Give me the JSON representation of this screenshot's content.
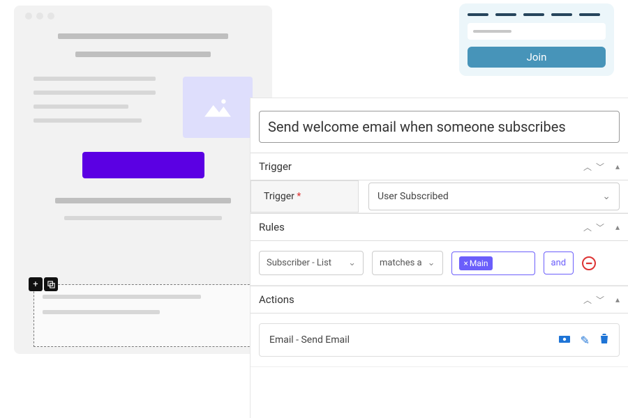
{
  "signup_widget": {
    "join_label": "Join"
  },
  "automation": {
    "title": "Send welcome email when someone subscribes",
    "sections": {
      "trigger": {
        "label": "Trigger",
        "field_label": "Trigger",
        "required_mark": "*",
        "select_value": "User Subscribed"
      },
      "rules": {
        "label": "Rules",
        "select_field": "Subscriber - List",
        "select_operator": "matches a",
        "chip_label": "Main",
        "chip_close": "×",
        "and_label": "and"
      },
      "actions": {
        "label": "Actions",
        "row_label": "Email - Send Email"
      }
    }
  }
}
